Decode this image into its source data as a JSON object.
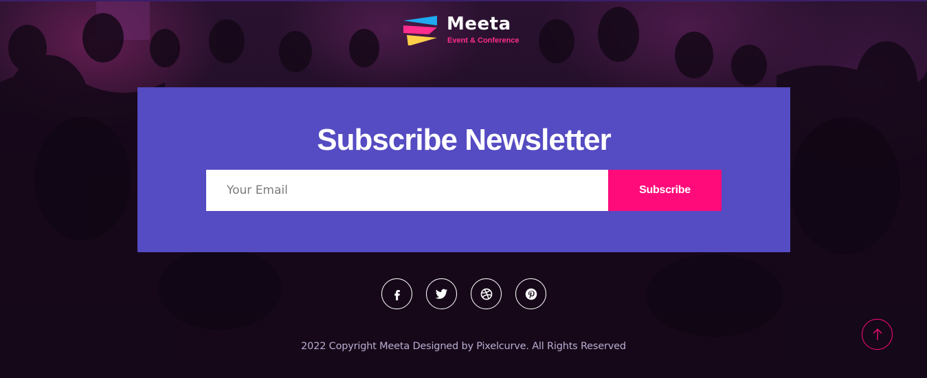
{
  "brand": {
    "name": "Meeta",
    "tagline": "Event & Conference",
    "colors": {
      "accent_pink": "#ff0b7a",
      "accent_purple": "#554bc2",
      "logo_blue": "#1fa9f0",
      "logo_yellow": "#ffcf4a"
    }
  },
  "newsletter": {
    "title": "Subscribe Newsletter",
    "email_placeholder": "Your Email",
    "email_value": "",
    "subscribe_label": "Subscribe"
  },
  "social": [
    {
      "icon": "facebook-icon",
      "name": "facebook"
    },
    {
      "icon": "twitter-icon",
      "name": "twitter"
    },
    {
      "icon": "dribbble-icon",
      "name": "dribbble"
    },
    {
      "icon": "pinterest-icon",
      "name": "pinterest"
    }
  ],
  "footer": {
    "copyright": "2022 Copyright Meeta Designed by Pixelcurve. All Rights Reserved"
  },
  "back_to_top": {
    "icon": "arrow-up-icon"
  }
}
